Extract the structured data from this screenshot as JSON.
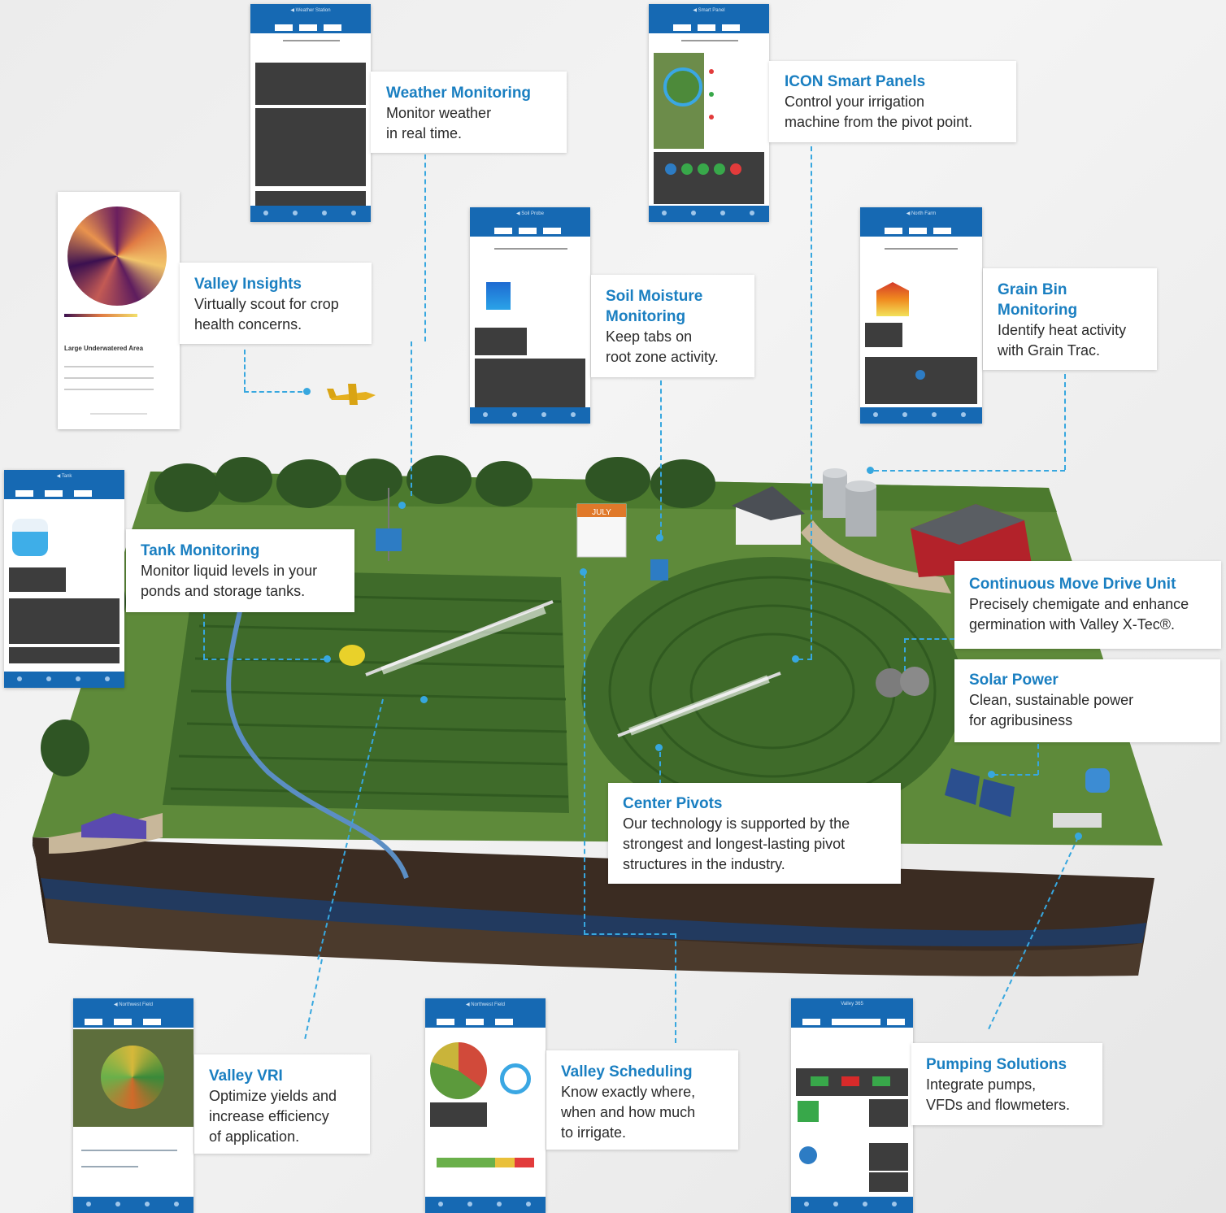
{
  "callouts": {
    "weather": {
      "title": "Weather Monitoring",
      "desc": "Monitor weather\nin real time."
    },
    "icon": {
      "title": "ICON Smart Panels",
      "desc": "Control your irrigation\nmachine from the pivot point."
    },
    "insights": {
      "title": "Valley Insights",
      "desc": "Virtually scout for crop\nhealth concerns."
    },
    "soil": {
      "title": "Soil Moisture\nMonitoring",
      "desc": "Keep tabs on\nroot zone activity."
    },
    "grain": {
      "title": "Grain Bin\nMonitoring",
      "desc": "Identify heat activity\nwith Grain Trac."
    },
    "tank": {
      "title": "Tank Monitoring",
      "desc": "Monitor liquid levels in your\nponds and storage tanks."
    },
    "cmdu": {
      "title": "Continuous Move Drive Unit",
      "desc": "Precisely chemigate and enhance\ngermination with Valley X-Tec®."
    },
    "solar": {
      "title": "Solar Power",
      "desc": "Clean, sustainable power\nfor agribusiness"
    },
    "pivots": {
      "title": "Center Pivots",
      "desc": "Our technology is supported by the\nstrongest and longest-lasting pivot\nstructures in the industry."
    },
    "vri": {
      "title": "Valley VRI",
      "desc": "Optimize yields and\nincrease efficiency\nof application."
    },
    "scheduling": {
      "title": "Valley Scheduling",
      "desc": "Know exactly where,\nwhen and how much\nto irrigate."
    },
    "pumping": {
      "title": "Pumping Solutions",
      "desc": "Integrate pumps,\nVFDs and flowmeters."
    }
  },
  "calendar_month": "JULY",
  "insights_card_title": "Large Underwatered Area",
  "colors": {
    "accent": "#1a7fc1",
    "app_header": "#1669b3",
    "connector": "#37a7df"
  }
}
